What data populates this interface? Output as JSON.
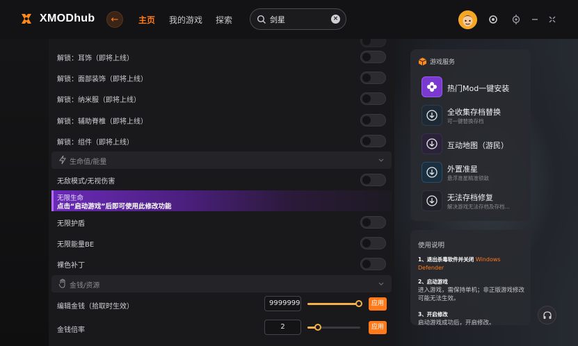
{
  "app": {
    "name": "XMODhub"
  },
  "nav": {
    "tabs": [
      {
        "label": "主页",
        "active": true
      },
      {
        "label": "我的游戏",
        "active": false
      },
      {
        "label": "探索",
        "active": false
      }
    ]
  },
  "search": {
    "value": "剑星",
    "placeholder": ""
  },
  "colors": {
    "accent": "#ff7a1a",
    "highlight_purple": "#6a2bb8",
    "slider": "#f5b04a"
  },
  "unlock_rows": [
    {
      "label": "解锁：耳饰（即将上线）"
    },
    {
      "label": "解锁：面部装饰（即将上线）"
    },
    {
      "label": "解锁：纳米服（即将上线）"
    },
    {
      "label": "解锁：辅助脊椎（即将上线）"
    },
    {
      "label": "解锁：组件（即将上线）"
    }
  ],
  "sections": {
    "health": {
      "label": "生命值/能量"
    },
    "money": {
      "label": "金钱/资源"
    }
  },
  "health_rows": {
    "invincible": {
      "label": "无敌模式/无视伤害"
    },
    "infinite_health": {
      "label": "无限生命",
      "hint": "点击“启动游戏”后即可使用此修改功能"
    },
    "infinite_shield": {
      "label": "无限护盾"
    },
    "infinite_be": {
      "label": "无限能量BE"
    },
    "nude_patch": {
      "label": "裸色补丁"
    }
  },
  "money_rows": {
    "edit_money": {
      "label": "编辑金钱（拾取时生效）",
      "value": "9999999",
      "slider_fraction": 0.98,
      "apply": "应用"
    },
    "money_rate": {
      "label": "金钱倍率",
      "value": "2",
      "slider_fraction": 0.2,
      "apply": "应用"
    }
  },
  "services": {
    "title": "游戏服务",
    "items": [
      {
        "title": "热门Mod一键安装",
        "sub": "",
        "icon": "flower-icon"
      },
      {
        "title": "全收集存档替换",
        "sub": "可一键替换存档",
        "icon": "download-icon"
      },
      {
        "title": "互动地图（游民）",
        "sub": "",
        "icon": "download-icon"
      },
      {
        "title": "外置准星",
        "sub": "悬浮准星精准锁敌",
        "icon": "crosshair-icon"
      },
      {
        "title": "无法存档修复",
        "sub": "解决游戏无法存档及存档...",
        "icon": "download-icon"
      }
    ]
  },
  "guide": {
    "title": "使用说明",
    "steps": [
      {
        "head": "1、退出杀毒软件并关闭",
        "body": "",
        "hl": "Windows Defender"
      },
      {
        "head": "2、启动游戏",
        "body": "进入游戏，需保持单机；非正版游戏修改可能无法生效。",
        "hl": ""
      },
      {
        "head": "3、开启修改",
        "body": "启动游戏成功后，开启修改。",
        "hl": ""
      }
    ]
  }
}
